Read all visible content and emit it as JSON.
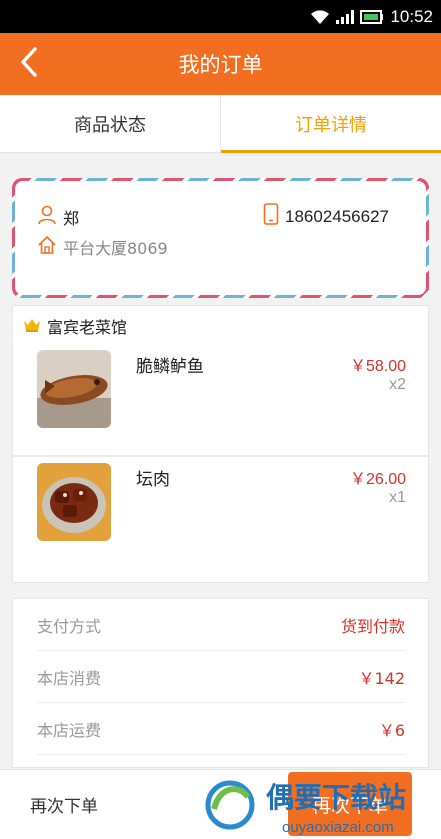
{
  "status_bar": {
    "time": "10:52"
  },
  "header": {
    "title": "我的订单"
  },
  "tabs": [
    {
      "label": "商品状态",
      "active": false
    },
    {
      "label": "订单详情",
      "active": true
    }
  ],
  "address": {
    "name": "郑",
    "phone": "18602456627",
    "location": "平台大厦8069"
  },
  "shop": {
    "name": "富宾老菜馆",
    "items": [
      {
        "name": "脆鳞鲈鱼",
        "price": "￥58.00",
        "qty": "x2"
      },
      {
        "name": "坛肉",
        "price": "￥26.00",
        "qty": "x1"
      }
    ]
  },
  "summary": {
    "rows": [
      {
        "label": "支付方式",
        "value": "货到付款"
      },
      {
        "label": "本店消费",
        "value": "￥142"
      },
      {
        "label": "本店运费",
        "value": "￥6"
      }
    ]
  },
  "bottom": {
    "reorder_label": "再次下单",
    "reorder_button": "再次下单"
  },
  "watermark": {
    "title": "偶要下载站",
    "url": "ouyaoxiazai.com"
  },
  "colors": {
    "accent": "#f26f21",
    "tab_active": "#f5a000",
    "price": "#d9302a"
  }
}
